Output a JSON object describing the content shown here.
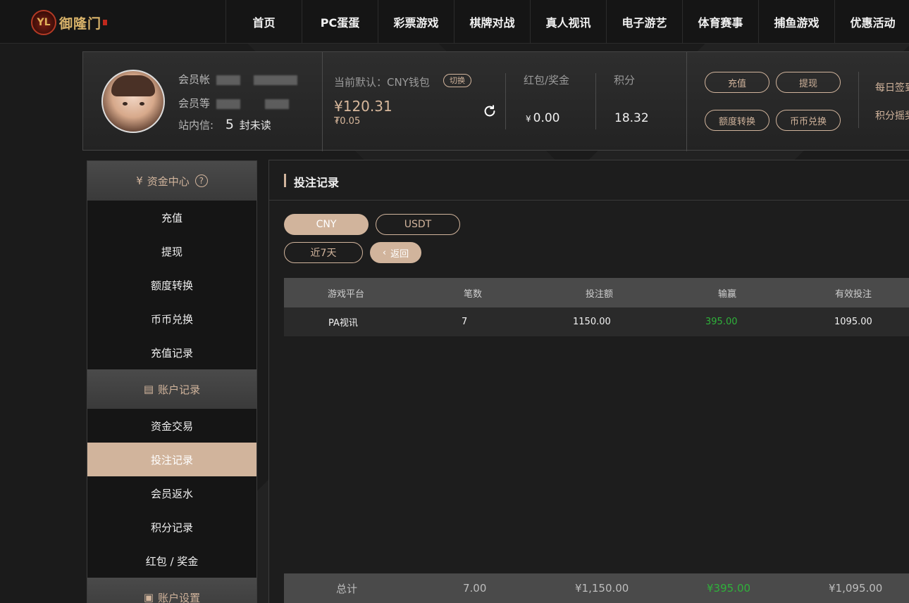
{
  "brand": {
    "logo_text": "御隆门"
  },
  "nav": {
    "items": [
      "首页",
      "PC蛋蛋",
      "彩票游戏",
      "棋牌对战",
      "真人视讯",
      "电子游艺",
      "体育赛事",
      "捕鱼游戏",
      "优惠活动"
    ]
  },
  "user": {
    "account_label": "会员帐",
    "level_label": "会员等",
    "message_label": "站内信:",
    "message_count": "5",
    "message_unread": "封未读",
    "wallet_label": "当前默认：CNY钱包",
    "switch_label": "切换",
    "wallet_amount": "¥120.31",
    "wallet_sub": "₮0.05",
    "bonus_label": "红包/奖金",
    "bonus_currency": "¥",
    "bonus_value": "0.00",
    "points_label": "积分",
    "points_value": "18.32",
    "buttons": {
      "deposit": "充值",
      "withdraw": "提现",
      "transfer": "额度转换",
      "coin_exchange": "币币兑换"
    },
    "daily_sign": "每日签到",
    "points_lottery": "积分摇奖"
  },
  "sidebar": {
    "sections": [
      {
        "title": "资金中心",
        "items": [
          "充值",
          "提现",
          "额度转换",
          "币币兑换",
          "充值记录"
        ]
      },
      {
        "title": "账户记录",
        "items": [
          "资金交易",
          "投注记录",
          "会员返水",
          "积分记录",
          "红包 / 奖金"
        ]
      },
      {
        "title": "账户设置",
        "items": []
      }
    ],
    "active_item": "投注记录"
  },
  "main": {
    "title": "投注记录",
    "currency_tabs": [
      "CNY",
      "USDT"
    ],
    "active_currency": "CNY",
    "period": "近7天",
    "back_label": "返回",
    "table": {
      "columns": [
        "游戏平台",
        "笔数",
        "投注额",
        "输赢",
        "有效投注"
      ],
      "rows": [
        {
          "platform": "PA视讯",
          "count": "7",
          "bet": "1150.00",
          "winloss": "395.00",
          "valid": "1095.00"
        }
      ],
      "footer": {
        "label": "总计",
        "count": "7.00",
        "bet": "¥1,150.00",
        "winloss": "¥395.00",
        "valid": "¥1,095.00"
      }
    }
  },
  "colors": {
    "accent": "#d1b49c",
    "win": "#2fb13a",
    "background": "#1b1b1b"
  }
}
